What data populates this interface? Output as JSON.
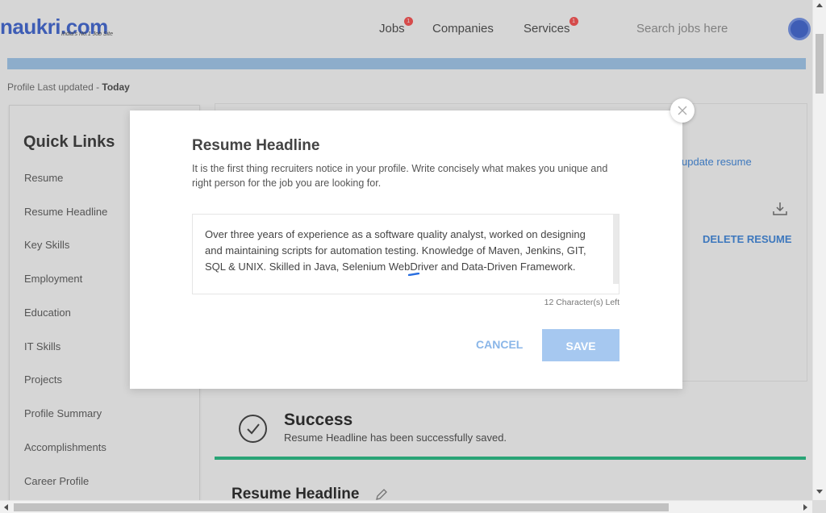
{
  "header": {
    "logo_text": "naukri.com",
    "logo_tagline": "India's No.1 Job Site",
    "nav": [
      {
        "label": "Jobs",
        "badge": "1"
      },
      {
        "label": "Companies",
        "badge": ""
      },
      {
        "label": "Services",
        "badge": "1"
      }
    ],
    "search_placeholder": "Search jobs here"
  },
  "profile": {
    "last_updated_label": "Profile Last updated - ",
    "last_updated_value": "Today"
  },
  "sidebar": {
    "title": "Quick Links",
    "items": [
      "Resume",
      "Resume Headline",
      "Key Skills",
      "Employment",
      "Education",
      "IT Skills",
      "Projects",
      "Profile Summary",
      "Accomplishments",
      "Career Profile"
    ]
  },
  "resume_card": {
    "update_link": "update resume",
    "delete_label": "DELETE RESUME"
  },
  "toast": {
    "title": "Success",
    "message": "Resume Headline has been successfully saved."
  },
  "section": {
    "title": "Resume Headline"
  },
  "modal": {
    "title": "Resume Headline",
    "description": "It is the first thing recruiters notice in your profile. Write concisely what makes you unique and right person for the job you are looking for.",
    "headline_value": "Over three years of experience as a software quality analyst, worked on designing and maintaining scripts for automation testing. Knowledge of Maven, Jenkins, GIT, SQL & UNIX. Skilled in Java, Selenium WebDriver and Data-Driven Framework.",
    "char_left": "12 Character(s) Left",
    "cancel_label": "CANCEL",
    "save_label": "SAVE"
  },
  "colors": {
    "brand": "#4a6fd8",
    "save_button": "#a6c8f0",
    "success": "#31c48d"
  }
}
